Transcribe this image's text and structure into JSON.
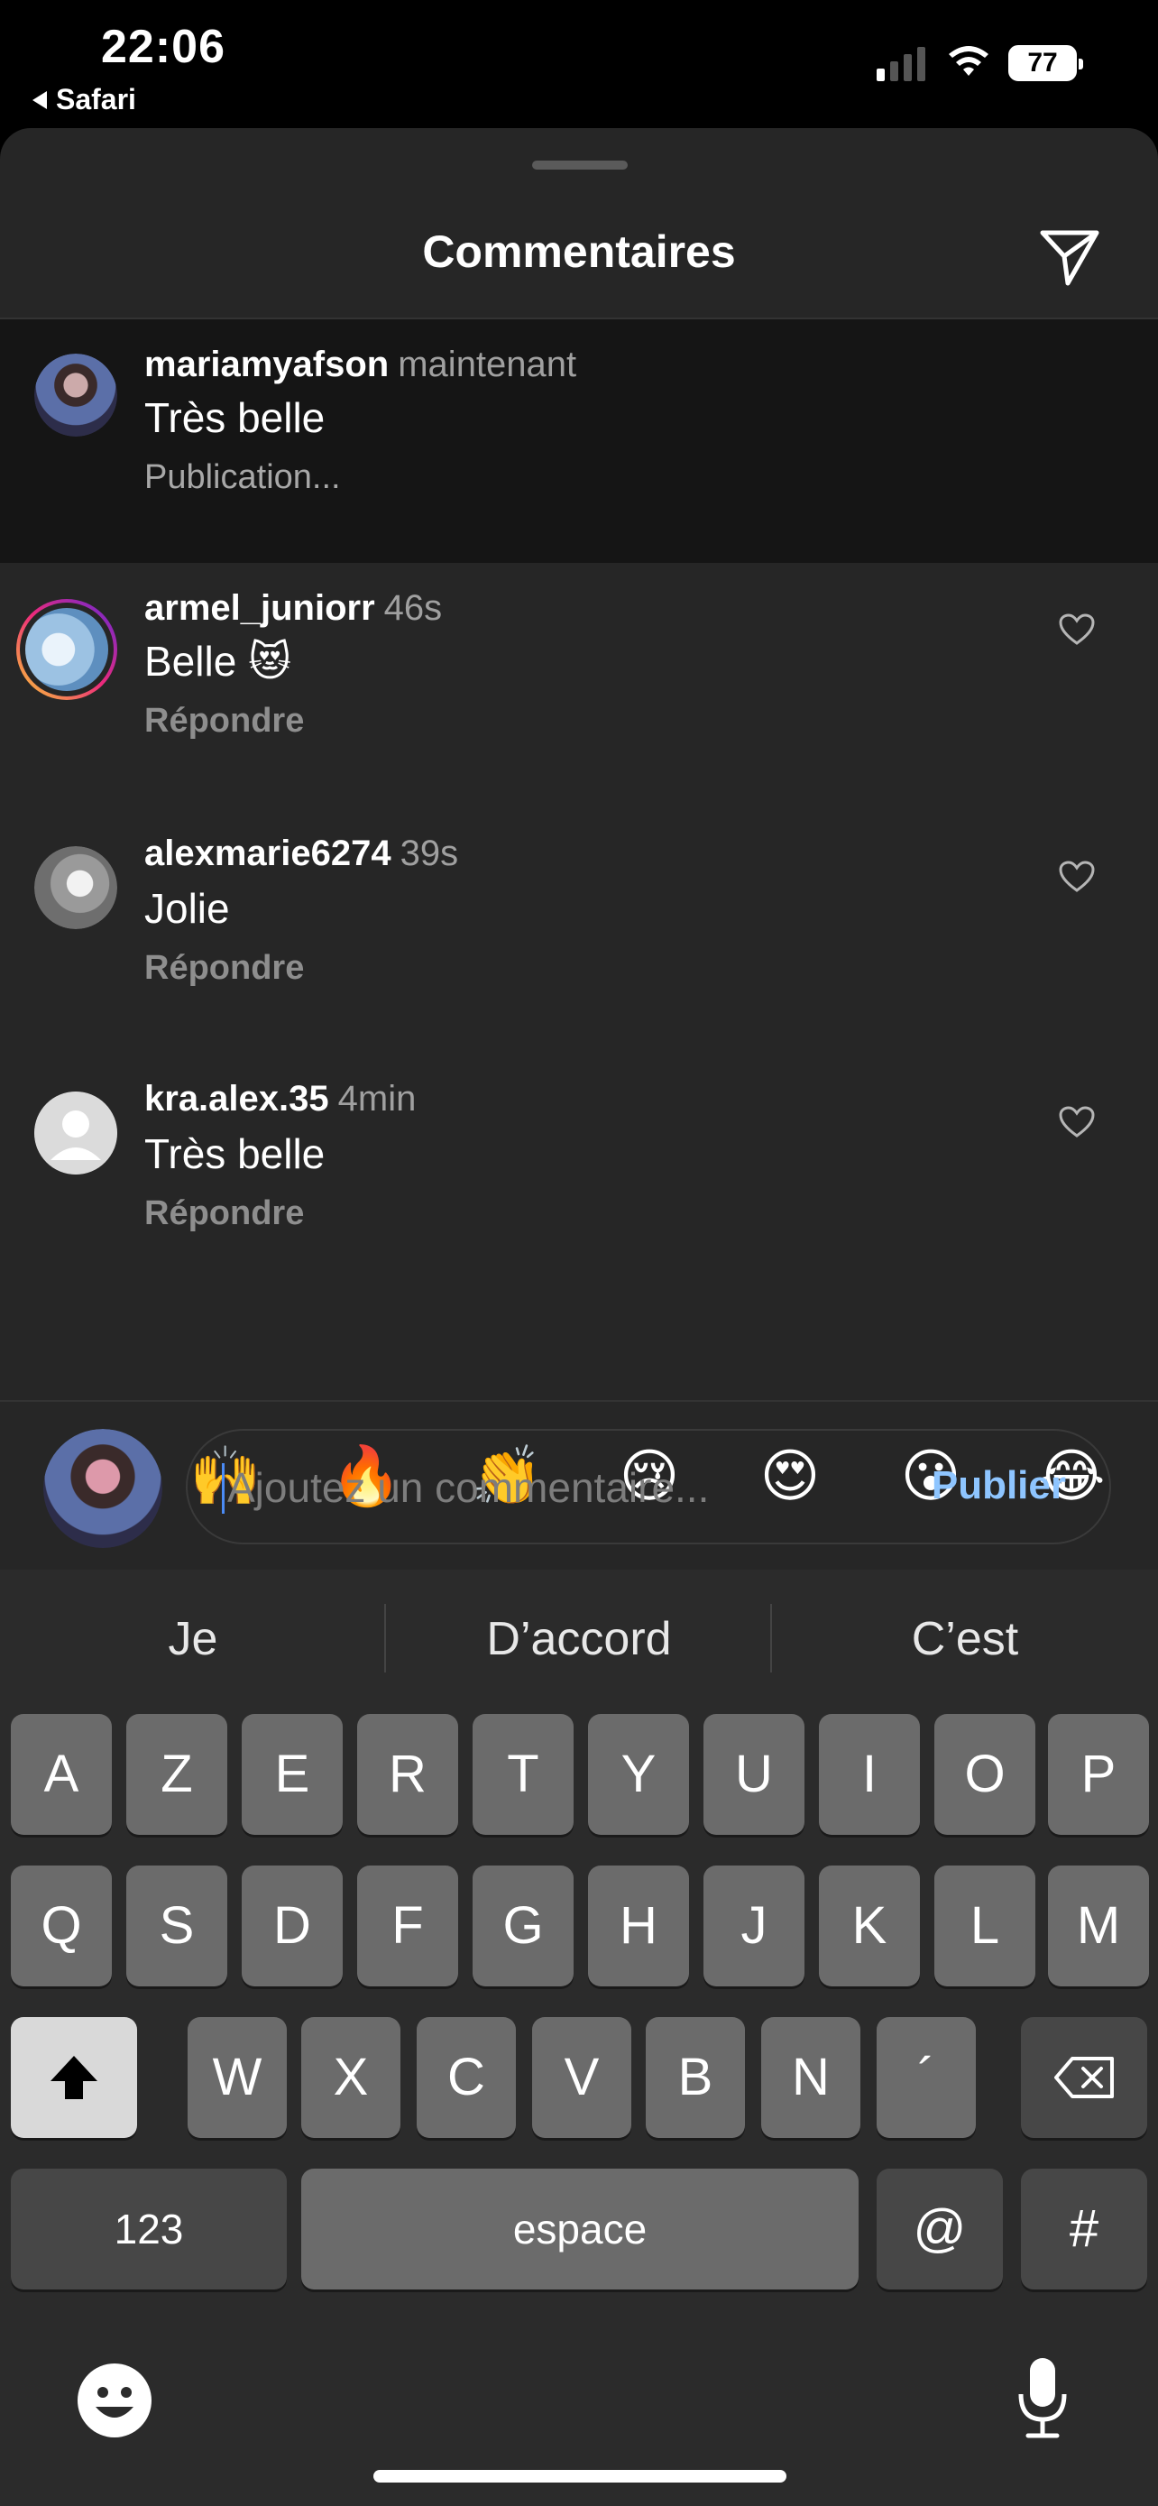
{
  "status_bar": {
    "time": "22:06",
    "back_app": "Safari",
    "battery": "77"
  },
  "sheet": {
    "title": "Commentaires"
  },
  "comments": [
    {
      "user": "mariamyafson",
      "time": "maintenant",
      "text": "Très belle",
      "action": "Publication..."
    },
    {
      "user": "armel_juniorr",
      "time": "46s",
      "text": "Belle 😻",
      "action": "Répondre"
    },
    {
      "user": "alexmarie6274",
      "time": "39s",
      "text": "Jolie",
      "action": "Répondre"
    },
    {
      "user": "kra.alex.35",
      "time": "4min",
      "text": "Très belle",
      "action": "Répondre"
    }
  ],
  "emoji_bar": [
    "❤️",
    "🙌",
    "🔥",
    "👏",
    "😢",
    "😍",
    "😮",
    "😂"
  ],
  "composer": {
    "placeholder": "Ajoutez un commentaire...",
    "publish_label": "Publier"
  },
  "keyboard": {
    "suggestions": [
      "Je",
      "D’accord",
      "C’est"
    ],
    "row1": [
      "A",
      "Z",
      "E",
      "R",
      "T",
      "Y",
      "U",
      "I",
      "O",
      "P"
    ],
    "row2": [
      "Q",
      "S",
      "D",
      "F",
      "G",
      "H",
      "J",
      "K",
      "L",
      "M"
    ],
    "row3": [
      "W",
      "X",
      "C",
      "V",
      "B",
      "N",
      "´"
    ],
    "numbers_label": "123",
    "space_label": "espace",
    "at_label": "@",
    "hash_label": "#"
  },
  "icons": {
    "back": "back-triangle-icon",
    "signal": "cellular-signal-icon",
    "wifi": "wifi-icon",
    "send": "paper-plane-icon",
    "like": "heart-outline-icon",
    "shift": "shift-arrow-icon",
    "delete": "backspace-icon",
    "emoji_keyboard": "smiley-icon",
    "dictation": "microphone-icon"
  },
  "colors": {
    "accent_link": "#8ec5ff",
    "caret": "#4b8bf5",
    "sheet_bg": "#262626",
    "pending_row_bg": "#151515"
  }
}
